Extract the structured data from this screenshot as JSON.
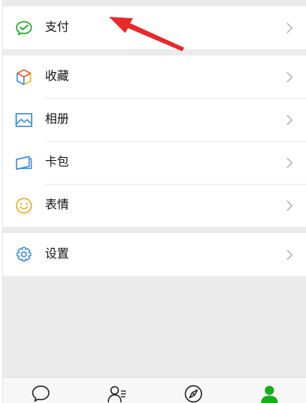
{
  "menu": {
    "pay": {
      "label": "支付",
      "icon": "wechat-pay-icon"
    },
    "favorites": {
      "label": "收藏",
      "icon": "cube-icon"
    },
    "album": {
      "label": "相册",
      "icon": "image-icon"
    },
    "cards": {
      "label": "卡包",
      "icon": "card-icon"
    },
    "stickers": {
      "label": "表情",
      "icon": "smiley-icon"
    },
    "settings": {
      "label": "设置",
      "icon": "gear-icon"
    }
  },
  "tabbar": {
    "tabs": [
      {
        "icon": "chat-bubble-icon",
        "active": false
      },
      {
        "icon": "contacts-icon",
        "active": false
      },
      {
        "icon": "compass-icon",
        "active": false
      },
      {
        "icon": "me-person-icon",
        "active": true
      }
    ]
  },
  "colors": {
    "accent_green": "#1aad19",
    "annotation_red": "#e8282b",
    "chevron": "#b2b2b2"
  }
}
